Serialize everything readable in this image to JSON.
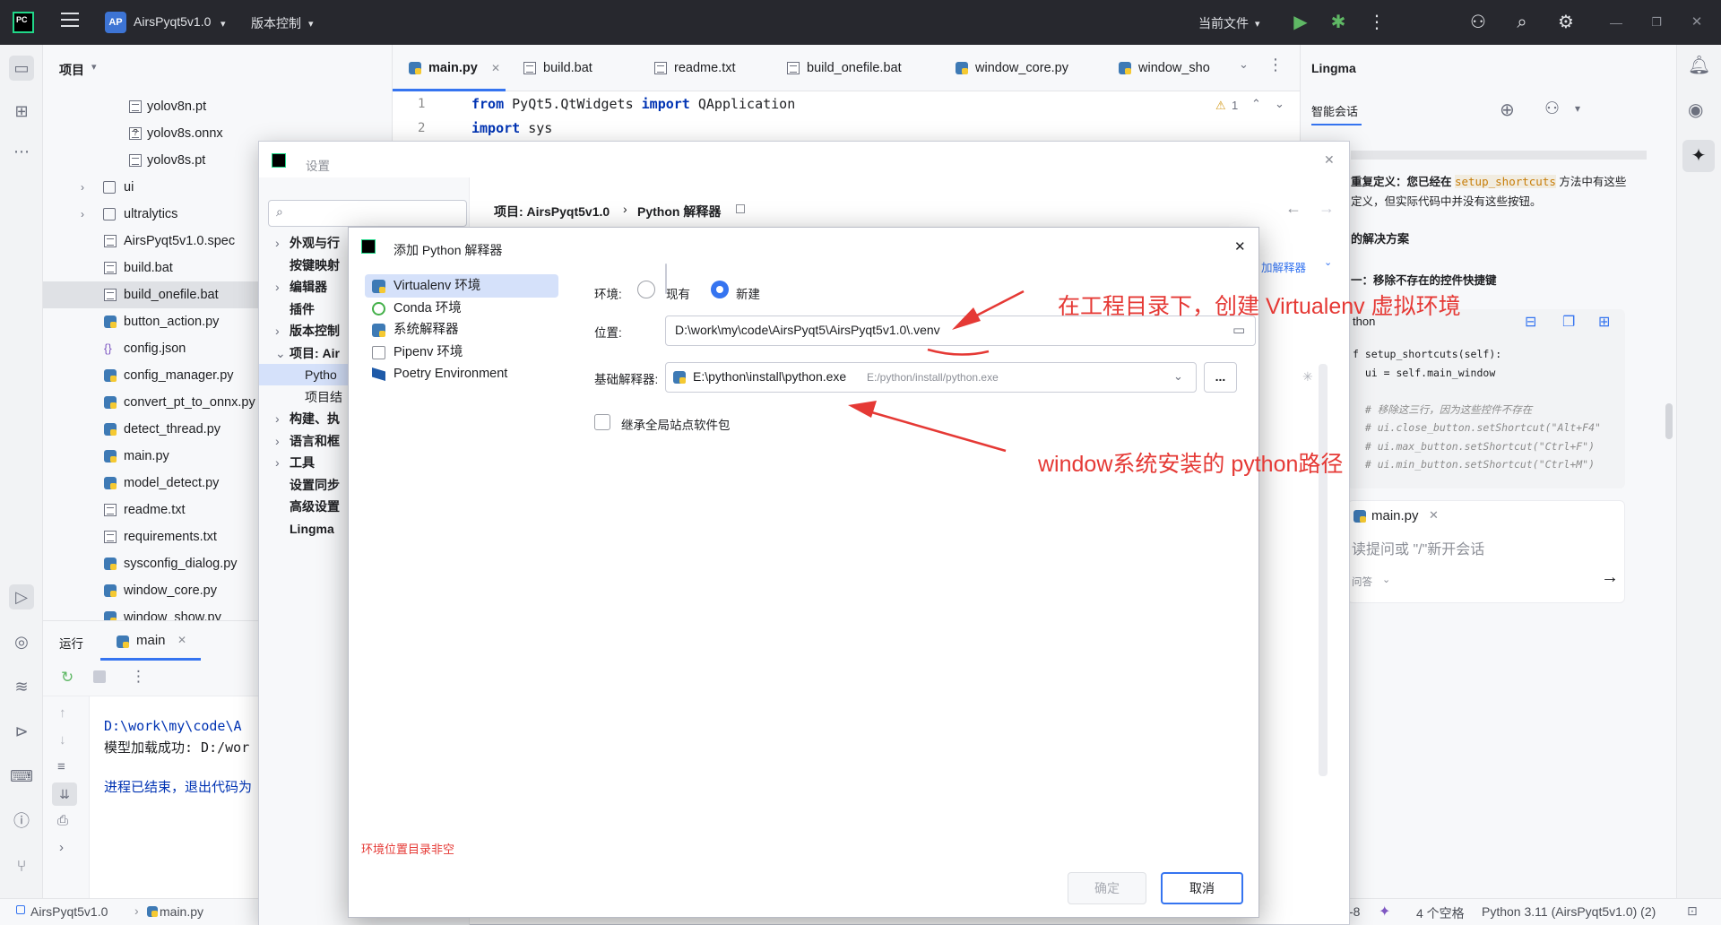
{
  "titlebar": {
    "logo": "PC",
    "project_badge": "AP",
    "project_name": "AirsPyqt5v1.0",
    "vcs_menu": "版本控制",
    "run_config": "当前文件",
    "icons": [
      "menu-icon",
      "run-icon",
      "debug-icon",
      "more-icon",
      "add-user-icon",
      "search-icon",
      "settings-icon",
      "minimize-icon",
      "restore-icon",
      "close-icon"
    ]
  },
  "project_panel": {
    "title": "项目",
    "tree": [
      {
        "label": "yolov8n.pt",
        "icon": "file-icon"
      },
      {
        "label": "yolov8s.onnx",
        "icon": "unknown-file-icon"
      },
      {
        "label": "yolov8s.pt",
        "icon": "file-icon"
      },
      {
        "label": "ui",
        "icon": "folder-icon",
        "collapsed": true
      },
      {
        "label": "ultralytics",
        "icon": "folder-icon",
        "collapsed": true
      },
      {
        "label": "AirsPyqt5v1.0.spec",
        "icon": "text-file-icon"
      },
      {
        "label": "build.bat",
        "icon": "text-file-icon"
      },
      {
        "label": "build_onefile.bat",
        "icon": "text-file-icon",
        "selected": true
      },
      {
        "label": "button_action.py",
        "icon": "python-file-icon"
      },
      {
        "label": "config.json",
        "icon": "json-file-icon"
      },
      {
        "label": "config_manager.py",
        "icon": "python-file-icon"
      },
      {
        "label": "convert_pt_to_onnx.py",
        "icon": "python-file-icon"
      },
      {
        "label": "detect_thread.py",
        "icon": "python-file-icon"
      },
      {
        "label": "main.py",
        "icon": "python-file-icon"
      },
      {
        "label": "model_detect.py",
        "icon": "python-file-icon"
      },
      {
        "label": "readme.txt",
        "icon": "text-file-icon"
      },
      {
        "label": "requirements.txt",
        "icon": "text-file-icon"
      },
      {
        "label": "sysconfig_dialog.py",
        "icon": "python-file-icon"
      },
      {
        "label": "window_core.py",
        "icon": "python-file-icon"
      },
      {
        "label": "window_show.py",
        "icon": "python-file-icon"
      }
    ]
  },
  "editor": {
    "tabs": [
      {
        "label": "main.py",
        "active": true,
        "closable": true
      },
      {
        "label": "build.bat"
      },
      {
        "label": "readme.txt"
      },
      {
        "label": "build_onefile.bat"
      },
      {
        "label": "window_core.py"
      },
      {
        "label": "window_sho"
      }
    ],
    "lines": [
      {
        "num": "1",
        "kw1": "from",
        "mid": " PyQt5.QtWidgets ",
        "kw2": "import",
        "rest": " QApplication"
      },
      {
        "num": "2",
        "kw1": "import",
        "mid": " sys",
        "kw2": "",
        "rest": ""
      }
    ],
    "warning_count": "1"
  },
  "lingma": {
    "title": "Lingma",
    "tab": "智能会话",
    "msg_line1_prefix": "重复定义：您已经在 ",
    "msg_line1_code": "setup_shortcuts",
    "msg_line1_suffix": " 方法中有这些",
    "msg_line2": "定义，但实际代码中并没有这些按钮。",
    "section_title": "的解决方案",
    "option_title": "一：移除不存在的控件快捷键",
    "code_lang": "thon",
    "code_lines": [
      "f setup_shortcuts(self):",
      "  ui = self.main_window",
      "",
      "  # 移除这三行，因为这些控件不存在",
      "  # ui.close_button.setShortcut(\"Alt+F4\"",
      "  # ui.max_button.setShortcut(\"Ctrl+F\")",
      "  # ui.min_button.setShortcut(\"Ctrl+M\")"
    ],
    "context_file": "main.py",
    "input_placeholder": "读提问或 \"/\"新开会话",
    "mode": "问答"
  },
  "run_panel": {
    "label": "运行",
    "tab": "main",
    "console": [
      {
        "text": "D:\\work\\my\\code\\A",
        "color": "#0033b3"
      },
      {
        "text": "模型加载成功: D:/wor",
        "color": "#1e1f22"
      },
      {
        "text": "",
        "color": "#1e1f22"
      },
      {
        "text": "进程已结束，退出代码为",
        "color": "#0033b3"
      }
    ]
  },
  "statusbar": {
    "crumb_project": "AirsPyqt5v1.0",
    "crumb_file": "main.py",
    "encoding_tail": "-8",
    "indent": "4 个空格",
    "interpreter": "Python 3.11 (AirsPyqt5v1.0) (2)"
  },
  "settings": {
    "title": "设置",
    "search_placeholder": "",
    "breadcrumb_project": "项目: AirsPyqt5v1.0",
    "breadcrumb_sep": "›",
    "breadcrumb_page": "Python 解释器",
    "add_interpreter_link": "加解释器",
    "nav": [
      {
        "label": "外观与行",
        "arrow": true
      },
      {
        "label": "按键映射",
        "arrow": false
      },
      {
        "label": "编辑器",
        "arrow": true
      },
      {
        "label": "插件",
        "arrow": false
      },
      {
        "label": "版本控制",
        "arrow": true
      },
      {
        "label": "项目: Air",
        "arrow": true,
        "expanded": true
      },
      {
        "label": "Pytho",
        "arrow": false,
        "child": true,
        "selected": true
      },
      {
        "label": "项目结",
        "arrow": false,
        "child": true
      },
      {
        "label": "构建、执",
        "arrow": true
      },
      {
        "label": "语言和框",
        "arrow": true
      },
      {
        "label": "工具",
        "arrow": true
      },
      {
        "label": "设置同步",
        "arrow": false
      },
      {
        "label": "高级设置",
        "arrow": false
      },
      {
        "label": "Lingma",
        "arrow": false
      }
    ]
  },
  "add_interpreter": {
    "title": "添加 Python 解释器",
    "types": [
      {
        "label": "Virtualenv 环境",
        "icon": "python-icon",
        "selected": true
      },
      {
        "label": "Conda 环境",
        "icon": "conda-icon"
      },
      {
        "label": "系统解释器",
        "icon": "python-icon"
      },
      {
        "label": "Pipenv 环境",
        "icon": "pipenv-icon"
      },
      {
        "label": "Poetry Environment",
        "icon": "poetry-icon"
      }
    ],
    "env_label": "环境:",
    "env_existing": "现有",
    "env_new": "新建",
    "env_selected": "新建",
    "location_label": "位置:",
    "location_value": "D:\\work\\my\\code\\AirsPyqt5\\AirsPyqt5v1.0\\.venv",
    "base_label": "基础解释器:",
    "base_value": "E:\\python\\install\\python.exe",
    "base_hint": "E:/python/install/python.exe",
    "browse_label": "...",
    "inherit_label": "继承全局站点软件包",
    "inherit_checked": false,
    "error_text": "环境位置目录非空",
    "ok_label": "确定",
    "cancel_label": "取消"
  },
  "annotations": {
    "top": "在工程目录下，创建 Virtualenv 虚拟环境",
    "bottom": "window系统安装的 python路径"
  },
  "colors": {
    "accent": "#3574f0",
    "annotation": "#e53935",
    "titlebar_bg": "#27282e",
    "error": "#e53935"
  }
}
